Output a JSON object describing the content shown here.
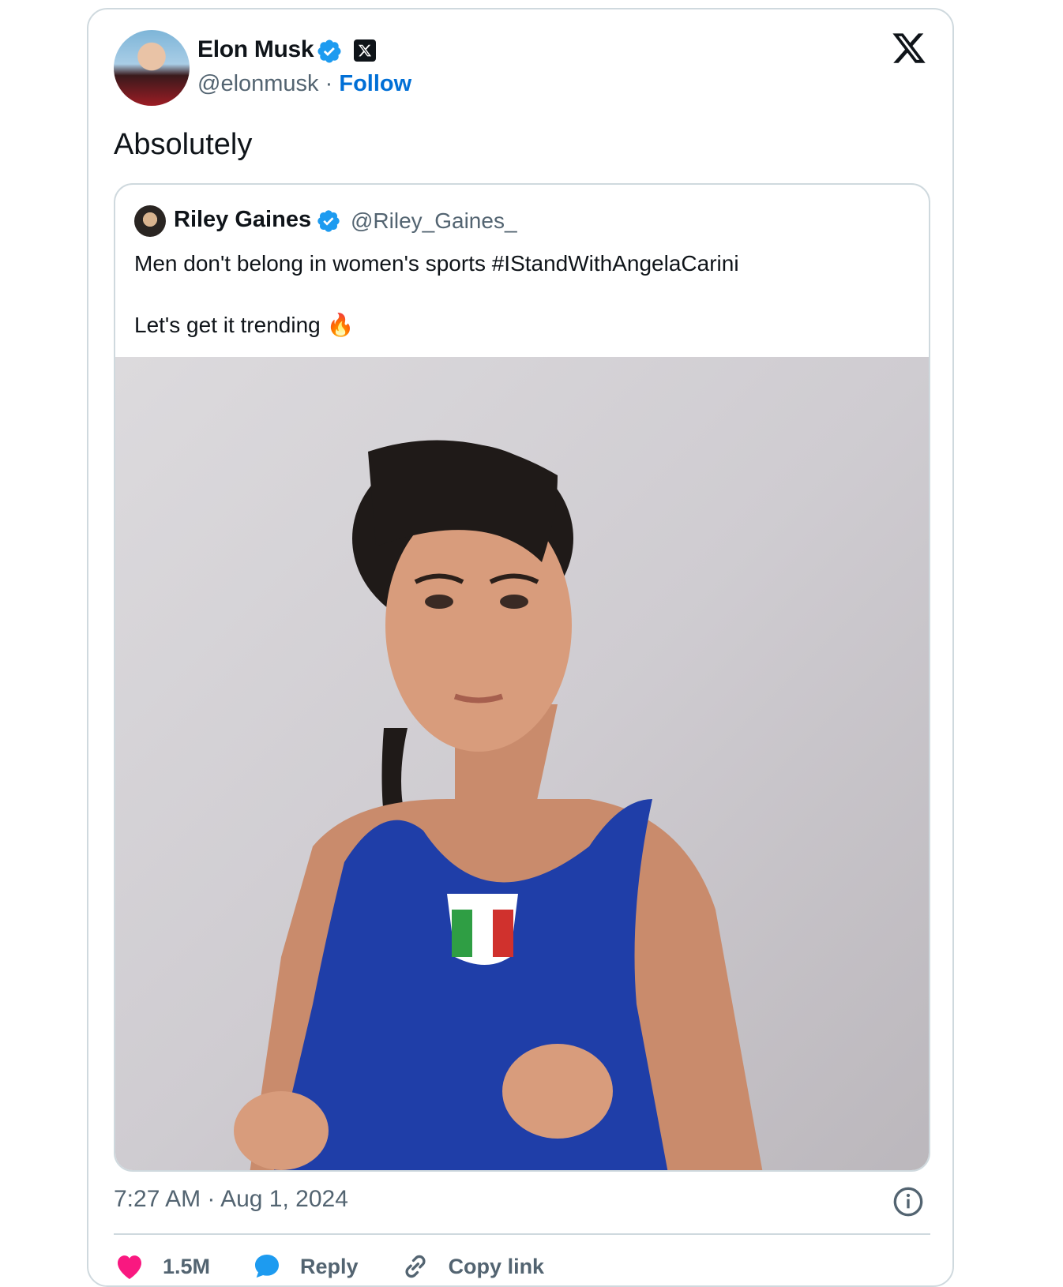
{
  "author": {
    "name": "Elon Musk",
    "handle": "@elonmusk",
    "separator": "·",
    "follow_label": "Follow"
  },
  "tweet": {
    "text": "Absolutely",
    "timestamp": "7:27 AM · Aug 1, 2024"
  },
  "quoted": {
    "name": "Riley Gaines",
    "handle": "@Riley_Gaines_",
    "line1": "Men don't belong in women's sports #IStandWithAngelaCarini",
    "line2": "Let's get it trending",
    "emoji": "🔥"
  },
  "actions": {
    "like_count": "1.5M",
    "reply_label": "Reply",
    "copy_label": "Copy link"
  },
  "colors": {
    "verified": "#1d9bf0",
    "like": "#f91880",
    "follow": "#006fd6",
    "muted": "#536471",
    "border": "#cfd9de"
  },
  "icons": [
    "verified-badge-icon",
    "x-affiliate-badge-icon",
    "x-logo-icon",
    "info-icon",
    "heart-icon",
    "reply-bubble-icon",
    "link-icon",
    "fire-emoji"
  ]
}
